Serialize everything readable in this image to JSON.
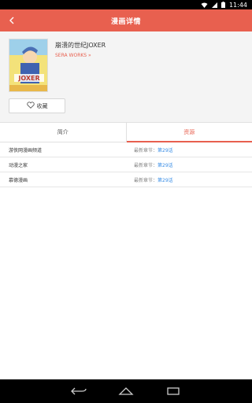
{
  "status_bar": {
    "time": "11:44",
    "icons": [
      "wifi-icon",
      "signal-icon",
      "battery-icon"
    ]
  },
  "app_bar": {
    "title": "漫画详情",
    "back_icon": "back-arrow-icon"
  },
  "manga": {
    "title": "崩溃的世纪JOXER",
    "author": "SERA WORKS »",
    "cover_alt": "JOXER"
  },
  "favorite": {
    "label": "收藏",
    "icon": "heart-outline-icon"
  },
  "tabs": [
    {
      "label": "简介",
      "active": false
    },
    {
      "label": "资源",
      "active": true
    }
  ],
  "sources": [
    {
      "name": "游侠网漫画频道",
      "chapter_prefix": "最新章节：",
      "chapter": "第29话"
    },
    {
      "name": "动漫之家",
      "chapter_prefix": "最新章节：",
      "chapter": "第29话"
    },
    {
      "name": "慕德漫画",
      "chapter_prefix": "最新章节：",
      "chapter": "第29话"
    }
  ],
  "nav_bar": {
    "buttons": [
      "back-nav-icon",
      "home-nav-icon",
      "recents-nav-icon"
    ]
  },
  "colors": {
    "accent": "#e8604f",
    "link": "#3a8ee6",
    "header_bg": "#f4f4f4"
  }
}
